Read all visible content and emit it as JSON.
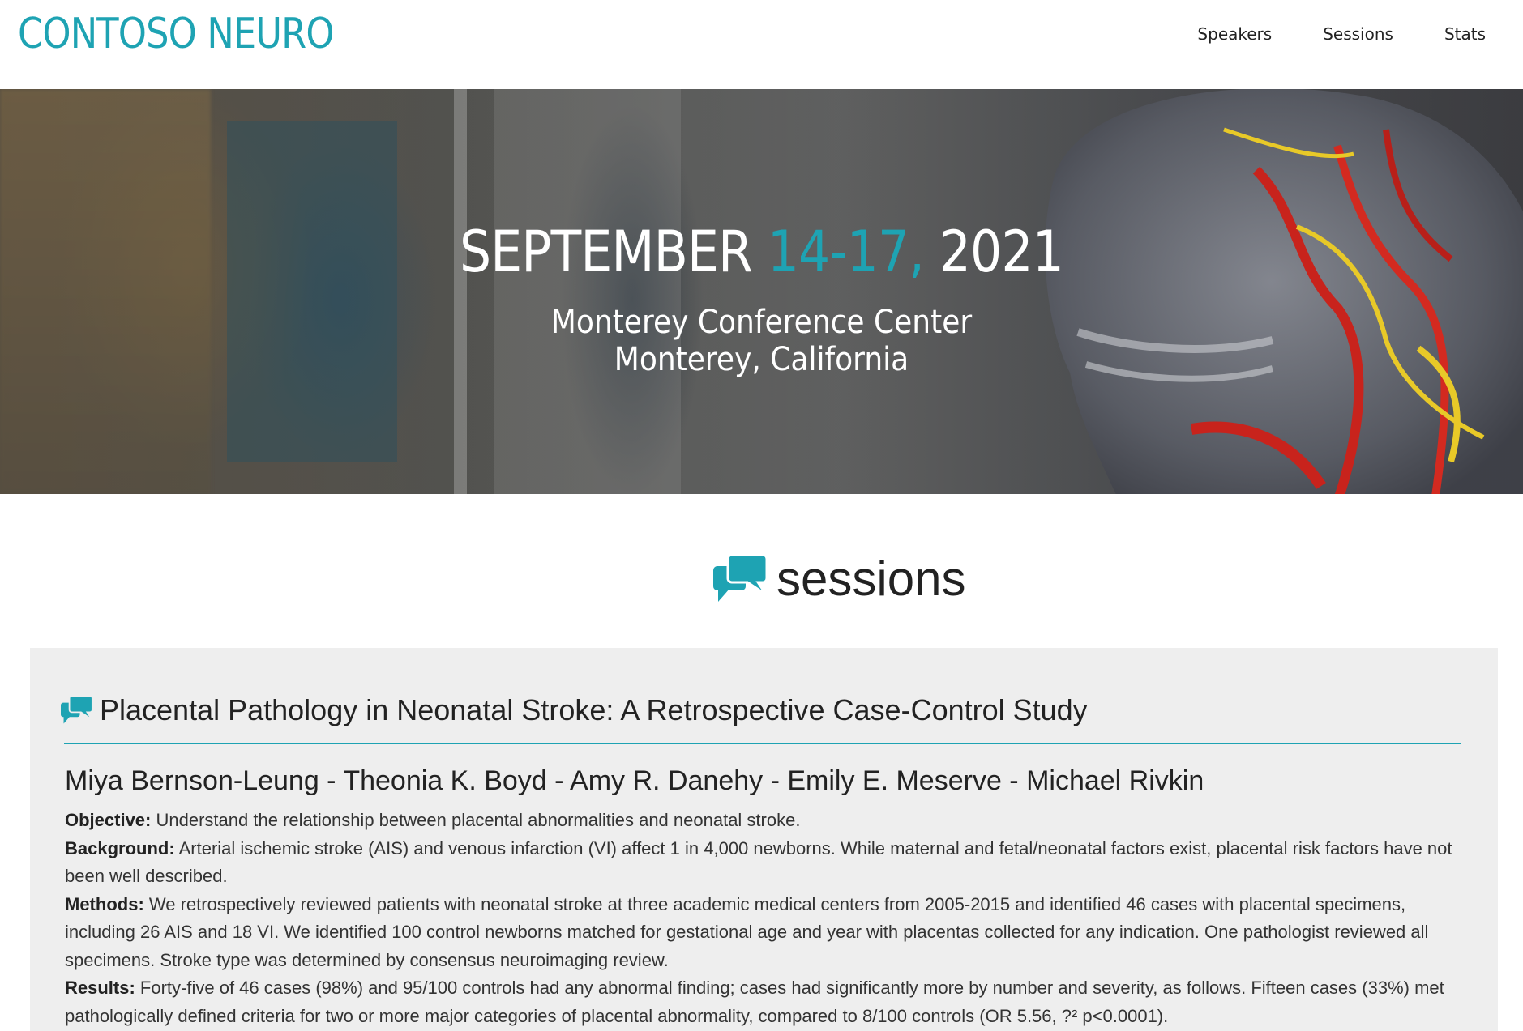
{
  "header": {
    "brand": "CONTOSO NEURO",
    "nav": [
      "Speakers",
      "Sessions",
      "Stats"
    ]
  },
  "hero": {
    "date_month": "SEPTEMBER",
    "date_days": "14-17,",
    "date_year": "2021",
    "venue_line1": "Monterey Conference Center",
    "venue_line2": "Monterey, California"
  },
  "sessions": {
    "heading": "sessions",
    "icon": "chat-bubbles-icon",
    "items": [
      {
        "title": "Placental Pathology in Neonatal Stroke: A Retrospective Case-Control Study",
        "authors": "Miya Bernson-Leung - Theonia K. Boyd - Amy R. Danehy - Emily E. Meserve - Michael Rivkin",
        "sections": [
          {
            "label": "Objective:",
            "text": "Understand the relationship between placental abnormalities and neonatal stroke."
          },
          {
            "label": "Background:",
            "text": "Arterial ischemic stroke (AIS) and venous infarction (VI) affect 1 in 4,000 newborns. While maternal and fetal/neonatal factors exist, placental risk factors have not been well described."
          },
          {
            "label": "Methods:",
            "text": "We retrospectively reviewed patients with neonatal stroke at three academic medical centers from 2005-2015 and identified 46 cases with placental specimens, including 26 AIS and 18 VI. We identified 100 control newborns matched for gestational age and year with placentas collected for any indication. One pathologist reviewed all specimens. Stroke type was determined by consensus neuroimaging review."
          },
          {
            "label": "Results:",
            "text": "Forty-five of 46 cases (98%) and 95/100 controls had any abnormal finding; cases had significantly more by number and severity, as follows. Fifteen cases (33%) met pathologically defined criteria for two or more major categories of placental abnormality, compared to 8/100 controls (OR 5.56, ?² p<0.0001)."
          }
        ]
      }
    ]
  },
  "colors": {
    "accent": "#1ea3b3",
    "card_background": "#eeeeee"
  }
}
